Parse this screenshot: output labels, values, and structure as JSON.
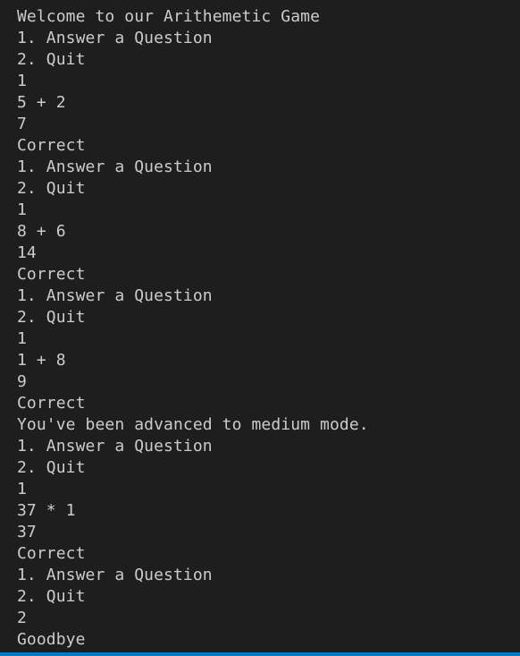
{
  "terminal": {
    "lines": [
      "Welcome to our Arithemetic Game",
      "1. Answer a Question",
      "2. Quit",
      "1",
      "5 + 2",
      "7",
      "Correct",
      "1. Answer a Question",
      "2. Quit",
      "1",
      "8 + 6",
      "14",
      "Correct",
      "1. Answer a Question",
      "2. Quit",
      "1",
      "1 + 8",
      "9",
      "Correct",
      "You've been advanced to medium mode.",
      "1. Answer a Question",
      "2. Quit",
      "1",
      "37 * 1",
      "37",
      "Correct",
      "1. Answer a Question",
      "2. Quit",
      "2",
      "Goodbye"
    ]
  },
  "colors": {
    "background": "#1e1e1e",
    "text": "#cccccc",
    "accent_strip": "#007acc"
  }
}
